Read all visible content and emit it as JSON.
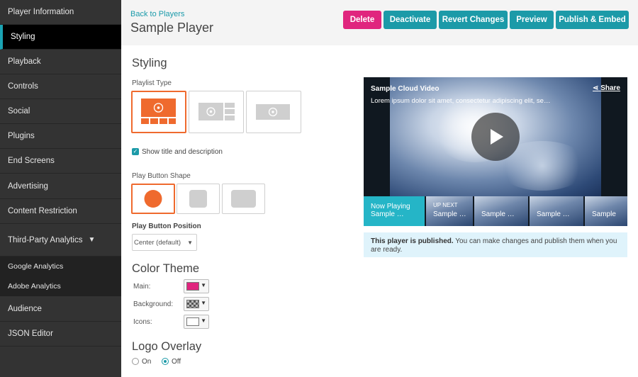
{
  "sidebar": {
    "items": [
      {
        "label": "Player Information",
        "active": false
      },
      {
        "label": "Styling",
        "active": true
      },
      {
        "label": "Playback",
        "active": false
      },
      {
        "label": "Controls",
        "active": false
      },
      {
        "label": "Social",
        "active": false
      },
      {
        "label": "Plugins",
        "active": false
      },
      {
        "label": "End Screens",
        "active": false
      },
      {
        "label": "Advertising",
        "active": false
      },
      {
        "label": "Content Restriction",
        "active": false
      },
      {
        "label": "Third-Party Analytics",
        "active": false,
        "expanded": true,
        "caret": "▼"
      },
      {
        "label": "Google Analytics",
        "sub": true
      },
      {
        "label": "Adobe Analytics",
        "sub": true
      },
      {
        "label": "Audience",
        "active": false
      },
      {
        "label": "JSON Editor",
        "active": false
      }
    ]
  },
  "header": {
    "back_link": "Back to Players",
    "title": "Sample Player",
    "buttons": {
      "delete": "Delete",
      "deactivate": "Deactivate",
      "revert": "Revert Changes",
      "preview": "Preview",
      "publish": "Publish & Embed"
    }
  },
  "styling": {
    "title": "Styling",
    "playlist_type_label": "Playlist Type",
    "playlist_type_selected": 0,
    "show_title_checked": true,
    "show_title_label": "Show title and description",
    "play_button_shape_label": "Play Button Shape",
    "play_button_shape_selected": 0,
    "play_button_position_label": "Play Button Position",
    "play_button_position_value": "Center (default)",
    "color_theme_title": "Color Theme",
    "colors": {
      "main_label": "Main:",
      "main_color": "#e0257e",
      "background_label": "Background:",
      "background_color": "transparent",
      "icons_label": "Icons:",
      "icons_color": "#ffffff"
    },
    "logo_overlay_title": "Logo Overlay",
    "logo_overlay_on": "On",
    "logo_overlay_off": "Off",
    "logo_overlay_value": "Off"
  },
  "player": {
    "video_title": "Sample Cloud Video",
    "video_description": "Lorem ipsum dolor sit amet, consectetur adipiscing elit, se…",
    "share_label": "Share",
    "now_playing_label": "Now Playing",
    "now_playing_title": "Sample …",
    "up_next_label": "UP NEXT",
    "thumbs": [
      "Sample …",
      "Sample …",
      "Sample …",
      "Sample"
    ]
  },
  "notice": {
    "bold": "This player is published.",
    "text": " You can make changes and publish them when you are ready."
  },
  "colors": {
    "accent_teal": "#1c9aa8",
    "delete_pink": "#e0257e",
    "selected_orange": "#ef6a2e",
    "sidebar_bg": "#333333"
  }
}
